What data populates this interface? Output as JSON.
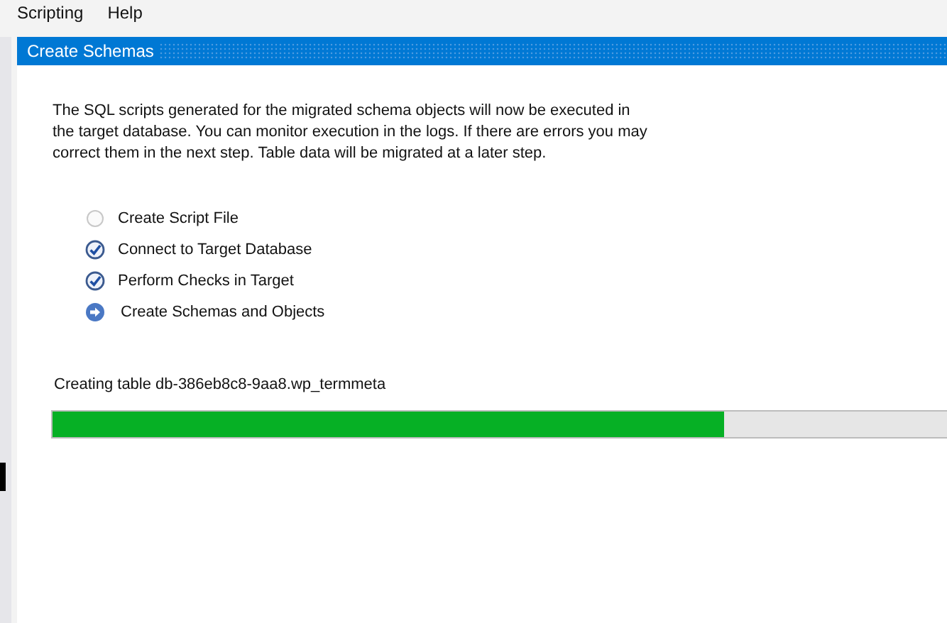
{
  "menu": [
    "Scripting",
    "Help"
  ],
  "panel": {
    "title": "Create Schemas"
  },
  "description": "The SQL scripts generated for the migrated schema objects will now be executed in the target database. You can monitor execution in the logs. If there are errors you may correct them in the next step. Table data will be migrated at a later step.",
  "steps": [
    {
      "label": "Create Script File",
      "kind": "pending"
    },
    {
      "label": "Connect to Target Database",
      "kind": "done"
    },
    {
      "label": "Perform Checks in Target",
      "kind": "done"
    },
    {
      "label": "Create Schemas and Objects",
      "kind": "current"
    }
  ],
  "progress": {
    "label": "Creating table db-386eb8c8-9aa8.wp_termmeta",
    "level": 0.75
  }
}
